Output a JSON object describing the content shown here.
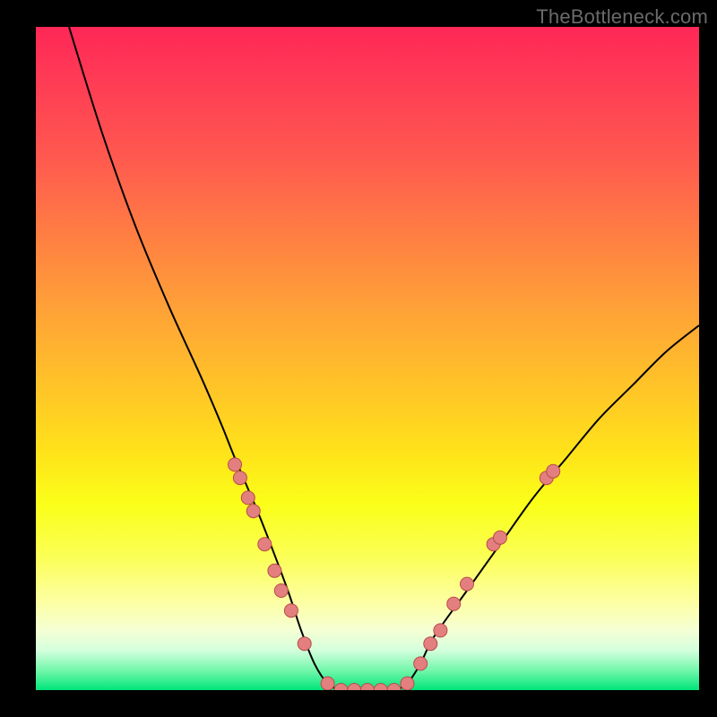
{
  "watermark": "TheBottleneck.com",
  "gradient_colors": {
    "top": "#ff2757",
    "mid_upper": "#ff8042",
    "mid": "#ffe21a",
    "mid_lower": "#fdffa6",
    "bottom": "#00e57a"
  },
  "curve_stroke": "#000000",
  "marker_fill": "#e3807f",
  "marker_stroke": "#b84c4a",
  "chart_data": {
    "type": "line",
    "title": "",
    "xlabel": "",
    "ylabel": "",
    "xlim": [
      0,
      100
    ],
    "ylim": [
      0,
      100
    ],
    "grid": false,
    "note": "V-shaped bottleneck curve. y ≈ 100 near x=0, drops to ~0 around x=45–55, rises back toward ~55 at x=100. Left arm is steeper than right. Markers cluster on the arms between y≈5 and y≈35 and along the valley floor at y≈0.",
    "series": [
      {
        "name": "curve",
        "x": [
          5,
          10,
          15,
          20,
          25,
          28,
          30,
          33,
          35,
          38,
          40,
          42,
          44,
          46,
          48,
          50,
          52,
          54,
          56,
          58,
          60,
          65,
          70,
          75,
          80,
          85,
          90,
          95,
          100
        ],
        "y": [
          100,
          84,
          70,
          58,
          47,
          40,
          35,
          28,
          23,
          15,
          9,
          4,
          1,
          0,
          0,
          0,
          0,
          0,
          1,
          4,
          8,
          15,
          22,
          29,
          35,
          41,
          46,
          51,
          55
        ]
      }
    ],
    "markers": {
      "name": "dots",
      "points": [
        {
          "x": 30,
          "y": 34
        },
        {
          "x": 30.8,
          "y": 32
        },
        {
          "x": 32,
          "y": 29
        },
        {
          "x": 32.8,
          "y": 27
        },
        {
          "x": 34.5,
          "y": 22
        },
        {
          "x": 36,
          "y": 18
        },
        {
          "x": 37,
          "y": 15
        },
        {
          "x": 38.5,
          "y": 12
        },
        {
          "x": 40.5,
          "y": 7
        },
        {
          "x": 44,
          "y": 1
        },
        {
          "x": 46,
          "y": 0
        },
        {
          "x": 48,
          "y": 0
        },
        {
          "x": 50,
          "y": 0
        },
        {
          "x": 52,
          "y": 0
        },
        {
          "x": 54,
          "y": 0
        },
        {
          "x": 56,
          "y": 1
        },
        {
          "x": 58,
          "y": 4
        },
        {
          "x": 59.5,
          "y": 7
        },
        {
          "x": 61,
          "y": 9
        },
        {
          "x": 63,
          "y": 13
        },
        {
          "x": 65,
          "y": 16
        },
        {
          "x": 69,
          "y": 22
        },
        {
          "x": 70,
          "y": 23
        },
        {
          "x": 77,
          "y": 32
        },
        {
          "x": 78,
          "y": 33
        }
      ]
    }
  }
}
